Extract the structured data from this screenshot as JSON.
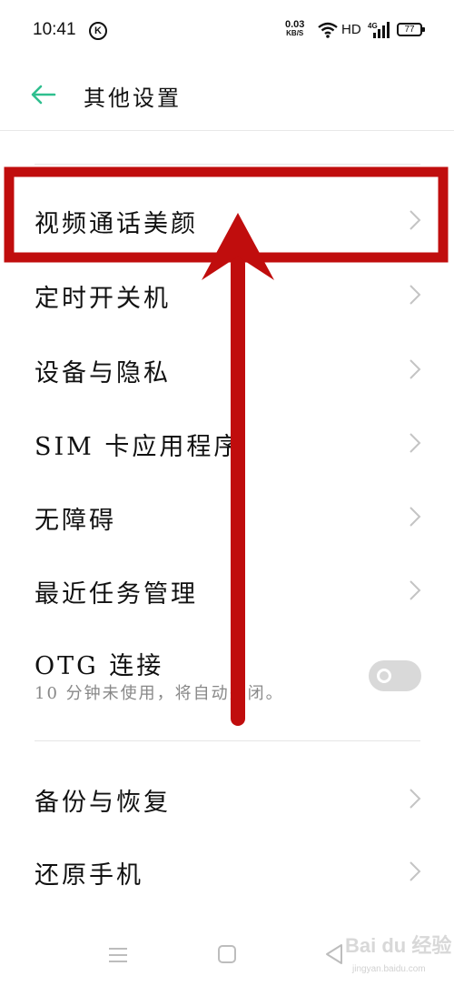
{
  "status_bar": {
    "time": "10:41",
    "k_badge": "K",
    "net_speed_value": "0.03",
    "net_speed_unit": "KB/S",
    "hd": "HD",
    "network_type": "4G",
    "battery": "77"
  },
  "header": {
    "title": "其他设置",
    "back_icon": "arrow-left-icon",
    "accent_color": "#2fbf8f"
  },
  "items": [
    {
      "label": "视频通话美颜"
    },
    {
      "label": "定时开关机"
    },
    {
      "label": "设备与隐私"
    },
    {
      "label": "SIM 卡应用程序"
    },
    {
      "label": "无障碍"
    },
    {
      "label": "最近任务管理"
    },
    {
      "label": "OTG 连接",
      "sub": "10 分钟未使用，将自动关闭。",
      "toggle": "off"
    },
    {
      "label": "备份与恢复"
    },
    {
      "label": "还原手机"
    }
  ],
  "annotation_color": "#c00d0d",
  "nav_icons": [
    "menu-icon",
    "home-square-icon",
    "back-triangle-icon"
  ],
  "watermark": {
    "text": "Bai du 经验",
    "sub": "jingyan.baidu.com"
  }
}
